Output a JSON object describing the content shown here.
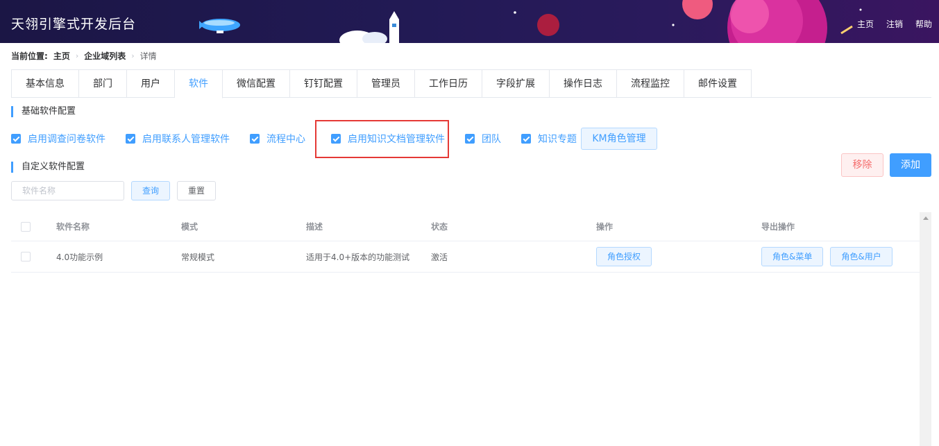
{
  "header": {
    "title": "天翎引擎式开发后台",
    "nav": [
      "主页",
      "注销",
      "帮助"
    ]
  },
  "breadcrumb": {
    "label": "当前位置:",
    "items": [
      "主页",
      "企业域列表",
      "详情"
    ]
  },
  "tabs": [
    "基本信息",
    "部门",
    "用户",
    "软件",
    "微信配置",
    "钉钉配置",
    "管理员",
    "工作日历",
    "字段扩展",
    "操作日志",
    "流程监控",
    "邮件设置"
  ],
  "active_tab": "软件",
  "basic_section": {
    "title": "基础软件配置",
    "checkboxes": [
      "启用调查问卷软件",
      "启用联系人管理软件",
      "流程中心",
      "启用知识文档管理软件",
      "团队",
      "知识专题"
    ],
    "km_button": "KM角色管理"
  },
  "custom_section": {
    "title": "自定义软件配置",
    "remove_button": "移除",
    "add_button": "添加",
    "search_placeholder": "软件名称",
    "query_button": "查询",
    "reset_button": "重置"
  },
  "table": {
    "headers": [
      "软件名称",
      "模式",
      "描述",
      "状态",
      "操作",
      "导出操作"
    ],
    "rows": [
      {
        "name": "4.0功能示例",
        "mode": "常规模式",
        "desc": "适用于4.0+版本的功能测试",
        "status": "激活",
        "action": "角色授权",
        "export_actions": [
          "角色&菜单",
          "角色&用户"
        ]
      }
    ]
  },
  "colors": {
    "primary": "#409eff",
    "danger": "#f56c6c",
    "header_bg": "#1b1645",
    "highlight_border": "#e53935"
  }
}
